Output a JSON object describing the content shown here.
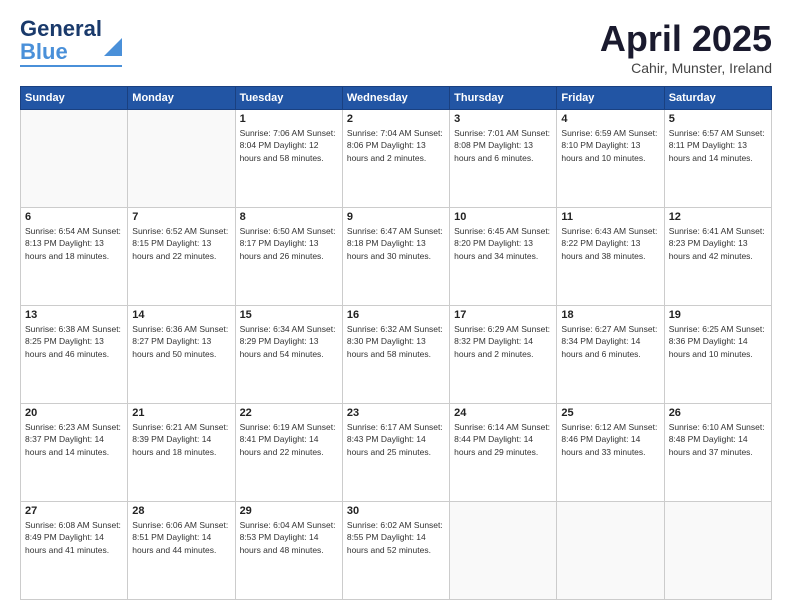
{
  "header": {
    "logo_line1": "General",
    "logo_line2": "Blue",
    "title": "April 2025",
    "location": "Cahir, Munster, Ireland"
  },
  "days_of_week": [
    "Sunday",
    "Monday",
    "Tuesday",
    "Wednesday",
    "Thursday",
    "Friday",
    "Saturday"
  ],
  "weeks": [
    [
      {
        "day": "",
        "info": ""
      },
      {
        "day": "",
        "info": ""
      },
      {
        "day": "1",
        "info": "Sunrise: 7:06 AM\nSunset: 8:04 PM\nDaylight: 12 hours\nand 58 minutes."
      },
      {
        "day": "2",
        "info": "Sunrise: 7:04 AM\nSunset: 8:06 PM\nDaylight: 13 hours\nand 2 minutes."
      },
      {
        "day": "3",
        "info": "Sunrise: 7:01 AM\nSunset: 8:08 PM\nDaylight: 13 hours\nand 6 minutes."
      },
      {
        "day": "4",
        "info": "Sunrise: 6:59 AM\nSunset: 8:10 PM\nDaylight: 13 hours\nand 10 minutes."
      },
      {
        "day": "5",
        "info": "Sunrise: 6:57 AM\nSunset: 8:11 PM\nDaylight: 13 hours\nand 14 minutes."
      }
    ],
    [
      {
        "day": "6",
        "info": "Sunrise: 6:54 AM\nSunset: 8:13 PM\nDaylight: 13 hours\nand 18 minutes."
      },
      {
        "day": "7",
        "info": "Sunrise: 6:52 AM\nSunset: 8:15 PM\nDaylight: 13 hours\nand 22 minutes."
      },
      {
        "day": "8",
        "info": "Sunrise: 6:50 AM\nSunset: 8:17 PM\nDaylight: 13 hours\nand 26 minutes."
      },
      {
        "day": "9",
        "info": "Sunrise: 6:47 AM\nSunset: 8:18 PM\nDaylight: 13 hours\nand 30 minutes."
      },
      {
        "day": "10",
        "info": "Sunrise: 6:45 AM\nSunset: 8:20 PM\nDaylight: 13 hours\nand 34 minutes."
      },
      {
        "day": "11",
        "info": "Sunrise: 6:43 AM\nSunset: 8:22 PM\nDaylight: 13 hours\nand 38 minutes."
      },
      {
        "day": "12",
        "info": "Sunrise: 6:41 AM\nSunset: 8:23 PM\nDaylight: 13 hours\nand 42 minutes."
      }
    ],
    [
      {
        "day": "13",
        "info": "Sunrise: 6:38 AM\nSunset: 8:25 PM\nDaylight: 13 hours\nand 46 minutes."
      },
      {
        "day": "14",
        "info": "Sunrise: 6:36 AM\nSunset: 8:27 PM\nDaylight: 13 hours\nand 50 minutes."
      },
      {
        "day": "15",
        "info": "Sunrise: 6:34 AM\nSunset: 8:29 PM\nDaylight: 13 hours\nand 54 minutes."
      },
      {
        "day": "16",
        "info": "Sunrise: 6:32 AM\nSunset: 8:30 PM\nDaylight: 13 hours\nand 58 minutes."
      },
      {
        "day": "17",
        "info": "Sunrise: 6:29 AM\nSunset: 8:32 PM\nDaylight: 14 hours\nand 2 minutes."
      },
      {
        "day": "18",
        "info": "Sunrise: 6:27 AM\nSunset: 8:34 PM\nDaylight: 14 hours\nand 6 minutes."
      },
      {
        "day": "19",
        "info": "Sunrise: 6:25 AM\nSunset: 8:36 PM\nDaylight: 14 hours\nand 10 minutes."
      }
    ],
    [
      {
        "day": "20",
        "info": "Sunrise: 6:23 AM\nSunset: 8:37 PM\nDaylight: 14 hours\nand 14 minutes."
      },
      {
        "day": "21",
        "info": "Sunrise: 6:21 AM\nSunset: 8:39 PM\nDaylight: 14 hours\nand 18 minutes."
      },
      {
        "day": "22",
        "info": "Sunrise: 6:19 AM\nSunset: 8:41 PM\nDaylight: 14 hours\nand 22 minutes."
      },
      {
        "day": "23",
        "info": "Sunrise: 6:17 AM\nSunset: 8:43 PM\nDaylight: 14 hours\nand 25 minutes."
      },
      {
        "day": "24",
        "info": "Sunrise: 6:14 AM\nSunset: 8:44 PM\nDaylight: 14 hours\nand 29 minutes."
      },
      {
        "day": "25",
        "info": "Sunrise: 6:12 AM\nSunset: 8:46 PM\nDaylight: 14 hours\nand 33 minutes."
      },
      {
        "day": "26",
        "info": "Sunrise: 6:10 AM\nSunset: 8:48 PM\nDaylight: 14 hours\nand 37 minutes."
      }
    ],
    [
      {
        "day": "27",
        "info": "Sunrise: 6:08 AM\nSunset: 8:49 PM\nDaylight: 14 hours\nand 41 minutes."
      },
      {
        "day": "28",
        "info": "Sunrise: 6:06 AM\nSunset: 8:51 PM\nDaylight: 14 hours\nand 44 minutes."
      },
      {
        "day": "29",
        "info": "Sunrise: 6:04 AM\nSunset: 8:53 PM\nDaylight: 14 hours\nand 48 minutes."
      },
      {
        "day": "30",
        "info": "Sunrise: 6:02 AM\nSunset: 8:55 PM\nDaylight: 14 hours\nand 52 minutes."
      },
      {
        "day": "",
        "info": ""
      },
      {
        "day": "",
        "info": ""
      },
      {
        "day": "",
        "info": ""
      }
    ]
  ]
}
